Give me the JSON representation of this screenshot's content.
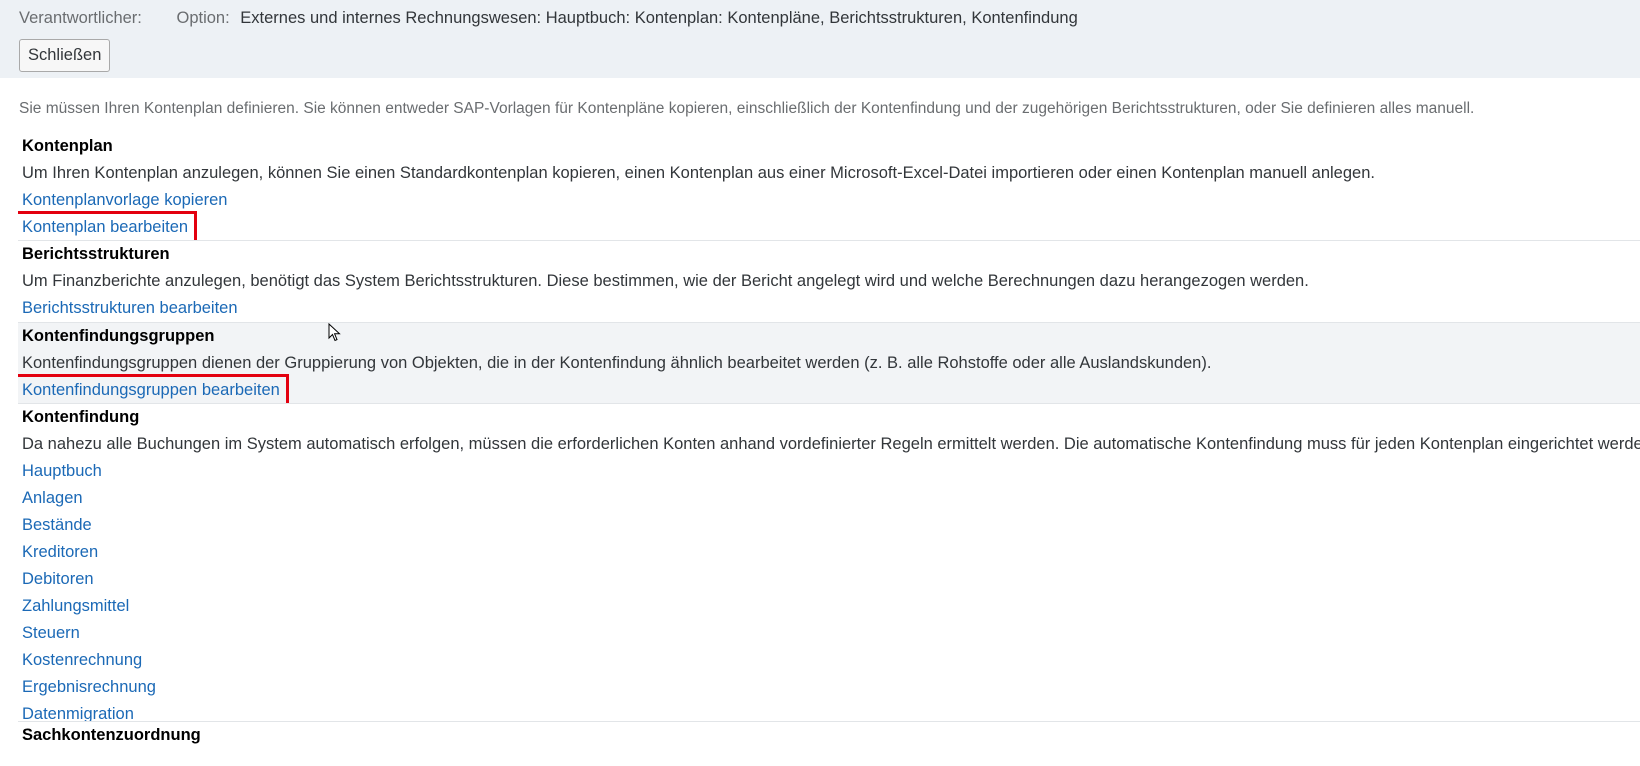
{
  "header": {
    "responsible_label": "Verantwortlicher:",
    "option_label": "Option:",
    "option_value": "Externes und internes Rechnungswesen: Hauptbuch: Kontenplan: Kontenpläne, Berichtsstrukturen, Kontenfindung",
    "close_button": "Schließen"
  },
  "intro": "Sie müssen Ihren Kontenplan definieren. Sie können entweder SAP-Vorlagen für Kontenpläne kopieren, einschließlich der Kontenfindung und der zugehörigen Berichtsstrukturen, oder Sie definieren alles manuell.",
  "sections": [
    {
      "title": "Kontenplan",
      "description": "Um Ihren Kontenplan anzulegen, können Sie einen Standardkontenplan kopieren, einen Kontenplan aus einer Microsoft-Excel-Datei importieren oder einen Kontenplan manuell anlegen.",
      "links": [
        "Kontenplanvorlage kopieren",
        "Kontenplan bearbeiten"
      ]
    },
    {
      "title": "Berichtsstrukturen",
      "description": "Um Finanzberichte anzulegen, benötigt das System Berichtsstrukturen. Diese bestimmen, wie der Bericht angelegt wird und welche Berechnungen dazu herangezogen werden.",
      "links": [
        "Berichtsstrukturen bearbeiten"
      ]
    },
    {
      "title": "Kontenfindungsgruppen",
      "description": "Kontenfindungsgruppen dienen der Gruppierung von Objekten, die in der Kontenfindung ähnlich bearbeitet werden (z. B. alle Rohstoffe oder alle Auslandskunden).",
      "links": [
        "Kontenfindungsgruppen bearbeiten"
      ]
    },
    {
      "title": "Kontenfindung",
      "description": "Da nahezu alle Buchungen im System automatisch erfolgen, müssen die erforderlichen Konten anhand vordefinierter Regeln ermittelt werden. Die automatische Kontenfindung muss für jeden Kontenplan eingerichtet werden.",
      "links": [
        "Hauptbuch",
        "Anlagen",
        "Bestände",
        "Kreditoren",
        "Debitoren",
        "Zahlungsmittel",
        "Steuern",
        "Kostenrechnung",
        "Ergebnisrechnung",
        "Datenmigration"
      ]
    },
    {
      "title": "Sachkontenzuordnung"
    }
  ],
  "colors": {
    "header_bg": "#edf1f5",
    "link": "#1b69b6",
    "highlight_border": "#e3000f",
    "shaded_section": "#f2f4f6"
  }
}
